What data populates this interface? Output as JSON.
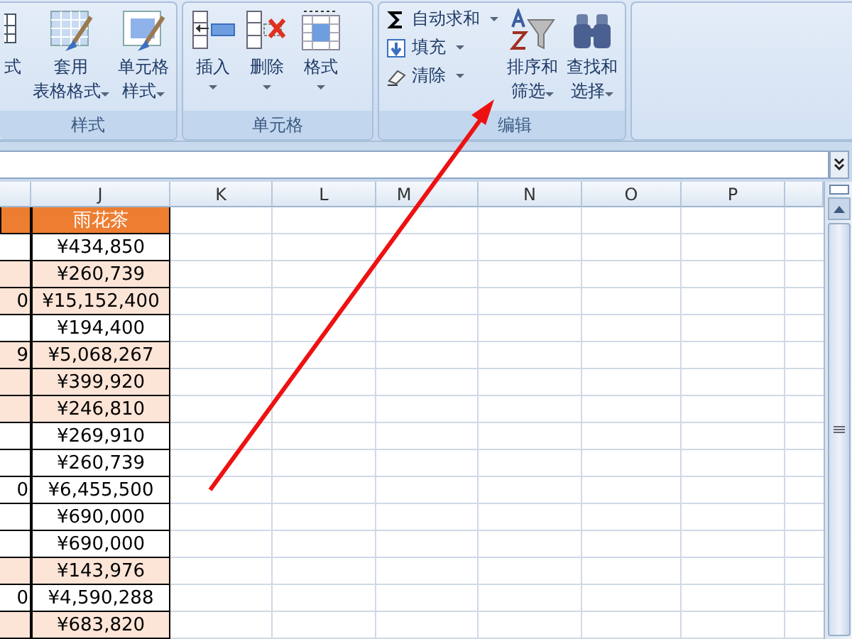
{
  "ribbon": {
    "groups": [
      {
        "label": "样式",
        "buttons": [
          {
            "kind": "cut",
            "lines": [
              "式"
            ],
            "dropdown": false
          },
          {
            "kind": "large",
            "lines": [
              "套用",
              "表格格式"
            ],
            "dropdown": true
          },
          {
            "kind": "large",
            "lines": [
              "单元格",
              "样式"
            ],
            "dropdown": true
          }
        ]
      },
      {
        "label": "单元格",
        "buttons": [
          {
            "kind": "large",
            "lines": [
              "插入"
            ],
            "dropdown": true
          },
          {
            "kind": "large",
            "lines": [
              "删除"
            ],
            "dropdown": true
          },
          {
            "kind": "large",
            "lines": [
              "格式"
            ],
            "dropdown": true
          }
        ]
      },
      {
        "label": "编辑",
        "buttons": [
          {
            "kind": "small",
            "lines": [
              "自动求和"
            ],
            "dropdown": true
          },
          {
            "kind": "small",
            "lines": [
              "填充"
            ],
            "dropdown": true
          },
          {
            "kind": "small",
            "lines": [
              "清除"
            ],
            "dropdown": true
          },
          {
            "kind": "large",
            "lines": [
              "排序和",
              "筛选"
            ],
            "dropdown": true
          },
          {
            "kind": "large",
            "lines": [
              "查找和",
              "选择"
            ],
            "dropdown": true
          }
        ]
      }
    ]
  },
  "sheet": {
    "columns": [
      "J",
      "K",
      "L",
      "M",
      "N",
      "O",
      "P"
    ],
    "header": {
      "value": "雨花茶"
    },
    "rows": [
      {
        "column_i": "",
        "value": "¥434,850",
        "highlighted": false
      },
      {
        "column_i": "",
        "value": "¥260,739",
        "highlighted": true
      },
      {
        "column_i": "0",
        "value": "¥15,152,400",
        "highlighted": true
      },
      {
        "column_i": "",
        "value": "¥194,400",
        "highlighted": false
      },
      {
        "column_i": "9",
        "value": "¥5,068,267",
        "highlighted": true
      },
      {
        "column_i": "",
        "value": "¥399,920",
        "highlighted": true
      },
      {
        "column_i": "",
        "value": "¥246,810",
        "highlighted": true
      },
      {
        "column_i": "",
        "value": "¥269,910",
        "highlighted": false
      },
      {
        "column_i": "",
        "value": "¥260,739",
        "highlighted": false
      },
      {
        "column_i": "0",
        "value": "¥6,455,500",
        "highlighted": false
      },
      {
        "column_i": "",
        "value": "¥690,000",
        "highlighted": false
      },
      {
        "column_i": "",
        "value": "¥690,000",
        "highlighted": false
      },
      {
        "column_i": "",
        "value": "¥143,976",
        "highlighted": true
      },
      {
        "column_i": "0",
        "value": "¥4,590,288",
        "highlighted": false
      },
      {
        "column_i": "",
        "value": "¥683,820",
        "highlighted": true
      }
    ]
  }
}
